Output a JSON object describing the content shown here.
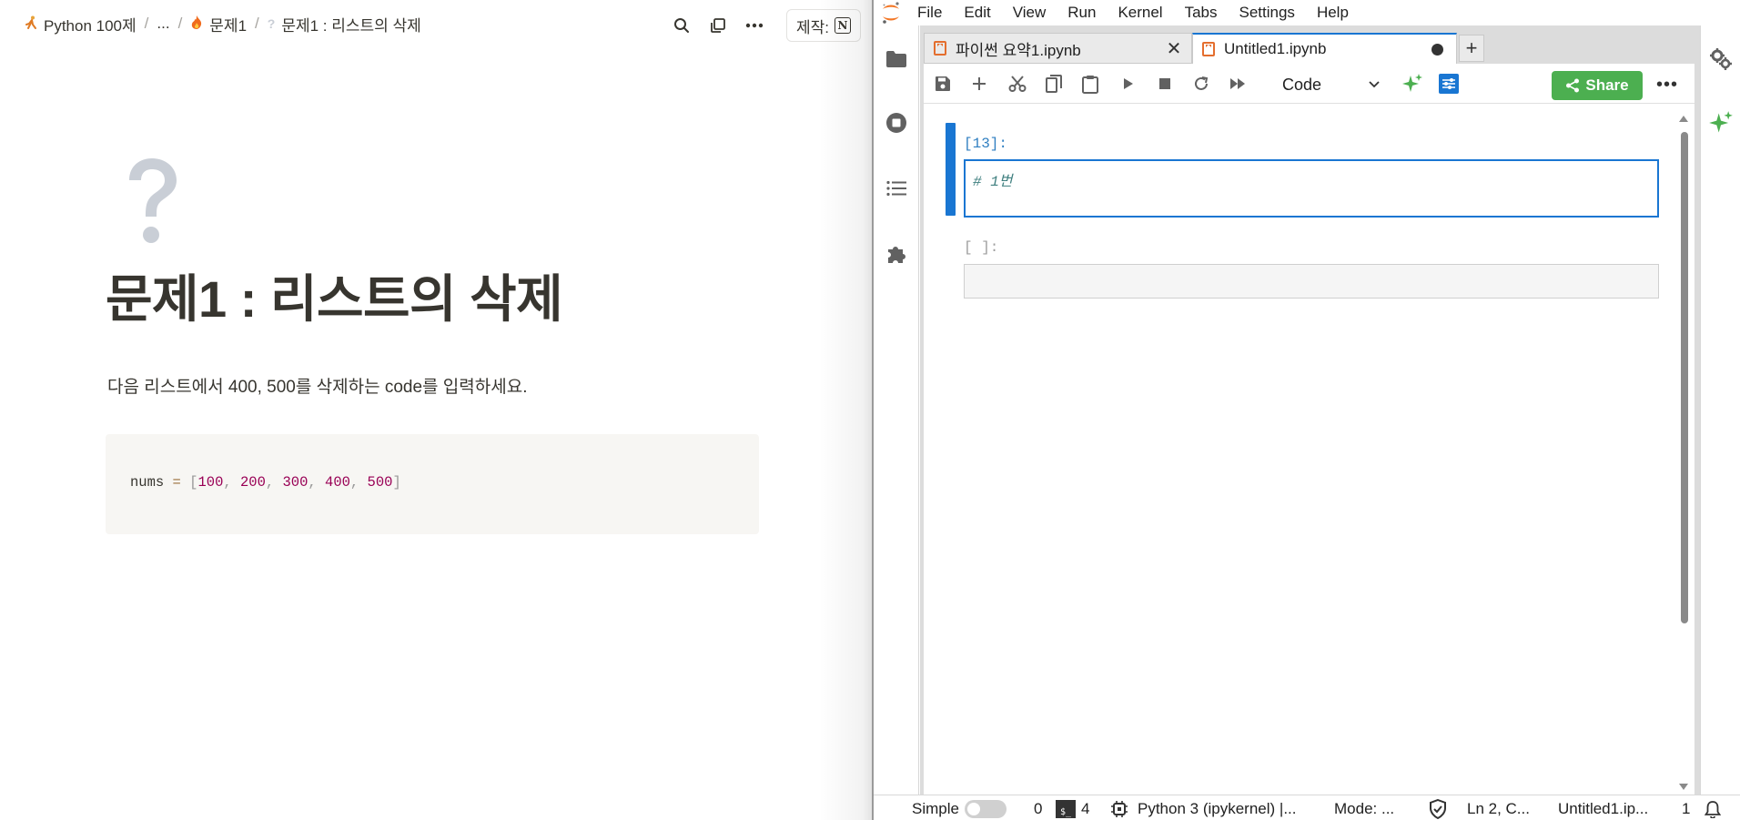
{
  "notion": {
    "breadcrumbs": [
      {
        "icon": "runner-icon",
        "label": "Python 100제"
      },
      {
        "icon": "",
        "label": "..."
      },
      {
        "icon": "fire-icon",
        "label": "문제1"
      },
      {
        "icon": "question-icon",
        "label": "문제1 : 리스트의 삭제"
      }
    ],
    "credit_label": "제작:",
    "page_icon": "question-mark",
    "title": "문제1 : 리스트의 삭제",
    "description": "다음 리스트에서 400, 500를 삭제하는 code를 입력하세요.",
    "code": {
      "var": "nums",
      "op": "=",
      "values": [
        "100",
        "200",
        "300",
        "400",
        "500"
      ]
    }
  },
  "jupyter": {
    "menu": [
      "File",
      "Edit",
      "View",
      "Run",
      "Kernel",
      "Tabs",
      "Settings",
      "Help"
    ],
    "tabs": [
      {
        "label": "파이썬 요약1.ipynb",
        "active": false
      },
      {
        "label": "Untitled1.ipynb",
        "active": true
      }
    ],
    "cell_type": "Code",
    "share_label": "Share",
    "cells": [
      {
        "prompt": "[13]:",
        "source": "# 1번"
      },
      {
        "prompt": "[ ]:",
        "source": ""
      }
    ],
    "status": {
      "mode_label": "Simple",
      "count_a": "0",
      "count_b": "4",
      "kernel": "Python 3 (ipykernel) |...",
      "mode": "Mode: ...",
      "cursor": "Ln 2, C...",
      "file": "Untitled1.ip...",
      "page": "1"
    }
  },
  "colors": {
    "accent": "#1976d2",
    "share": "#4caf50",
    "jupyter_orange": "#f37726",
    "ai_green": "#4caf50"
  }
}
